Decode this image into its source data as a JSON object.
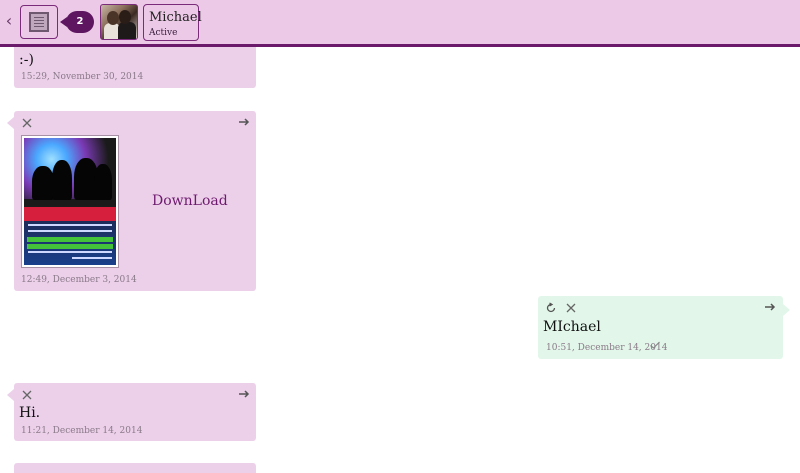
{
  "header": {
    "back_icon": "chevron-left-icon",
    "menu_icon": "notepad-icon",
    "badge_count": "2",
    "contact_name": "Michael",
    "contact_status": "Active"
  },
  "messages": [
    {
      "direction": "incoming",
      "text": ":-)",
      "time": "15:29, November 30, 2014"
    },
    {
      "direction": "incoming",
      "type": "file",
      "link_text": "DownLoad",
      "time": "12:49, December 3, 2014",
      "thumbnail_text": "Bubanee Music"
    },
    {
      "direction": "outgoing",
      "text": "MIchael",
      "time": "10:51, December 14, 2014",
      "status_icon": "checkmark-icon"
    },
    {
      "direction": "incoming",
      "text": "Hi.",
      "time": "11:21, December 14, 2014"
    }
  ],
  "colors": {
    "header_bg": "#ecc9e6",
    "header_border": "#6b1a6b",
    "incoming_bubble": "#ecd0ea",
    "outgoing_bubble": "#e2f7ea",
    "badge": "#5e1660"
  }
}
